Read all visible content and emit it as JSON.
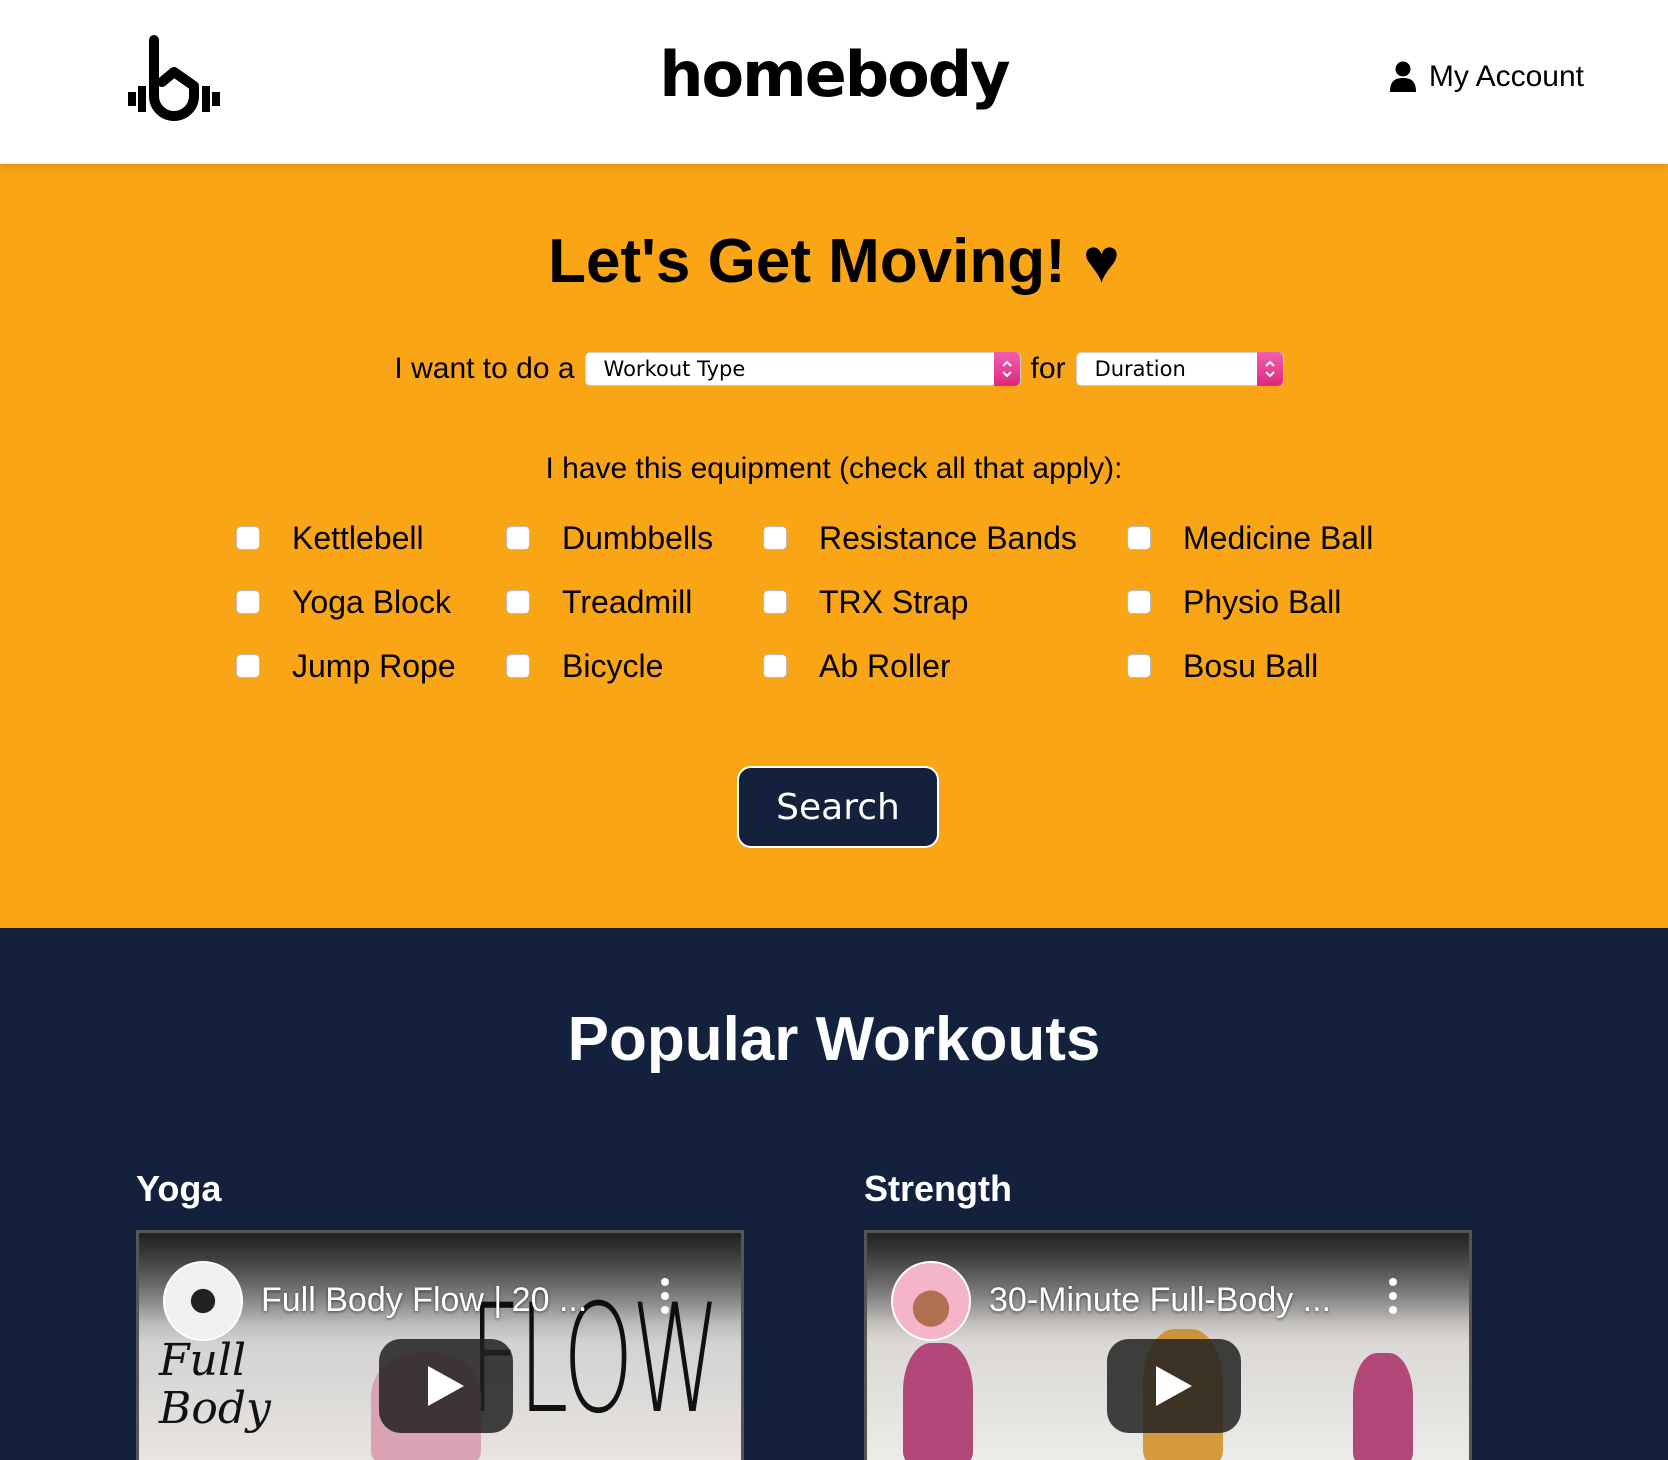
{
  "header": {
    "brand": "homebody",
    "account_label": "My Account"
  },
  "search": {
    "title": "Let's Get Moving! ♥",
    "prefix": "I want to do a",
    "workout_select": "Workout Type",
    "connector": "for",
    "duration_select": "Duration",
    "equipment_label": "I have this equipment (check all that apply):",
    "equipment": [
      "Kettlebell",
      "Dumbbells",
      "Resistance Bands",
      "Medicine Ball",
      "Yoga Block",
      "Treadmill",
      "TRX Strap",
      "Physio Ball",
      "Jump Rope",
      "Bicycle",
      "Ab Roller",
      "Bosu Ball"
    ],
    "button": "Search"
  },
  "popular": {
    "title": "Popular Workouts",
    "categories": [
      {
        "label": "Yoga",
        "video_title": "Full Body Flow | 20 ...",
        "overlay_big": "FLOW",
        "overlay_script": "Full Body"
      },
      {
        "label": "Strength",
        "video_title": "30-Minute Full-Body ..."
      }
    ]
  },
  "colors": {
    "accent": "#f9a516",
    "navy": "#14213d",
    "select_arrow": "#e0287a"
  },
  "icons": [
    "logo-icon",
    "user-icon",
    "select-arrow-icon",
    "play-icon",
    "more-vert-icon"
  ]
}
